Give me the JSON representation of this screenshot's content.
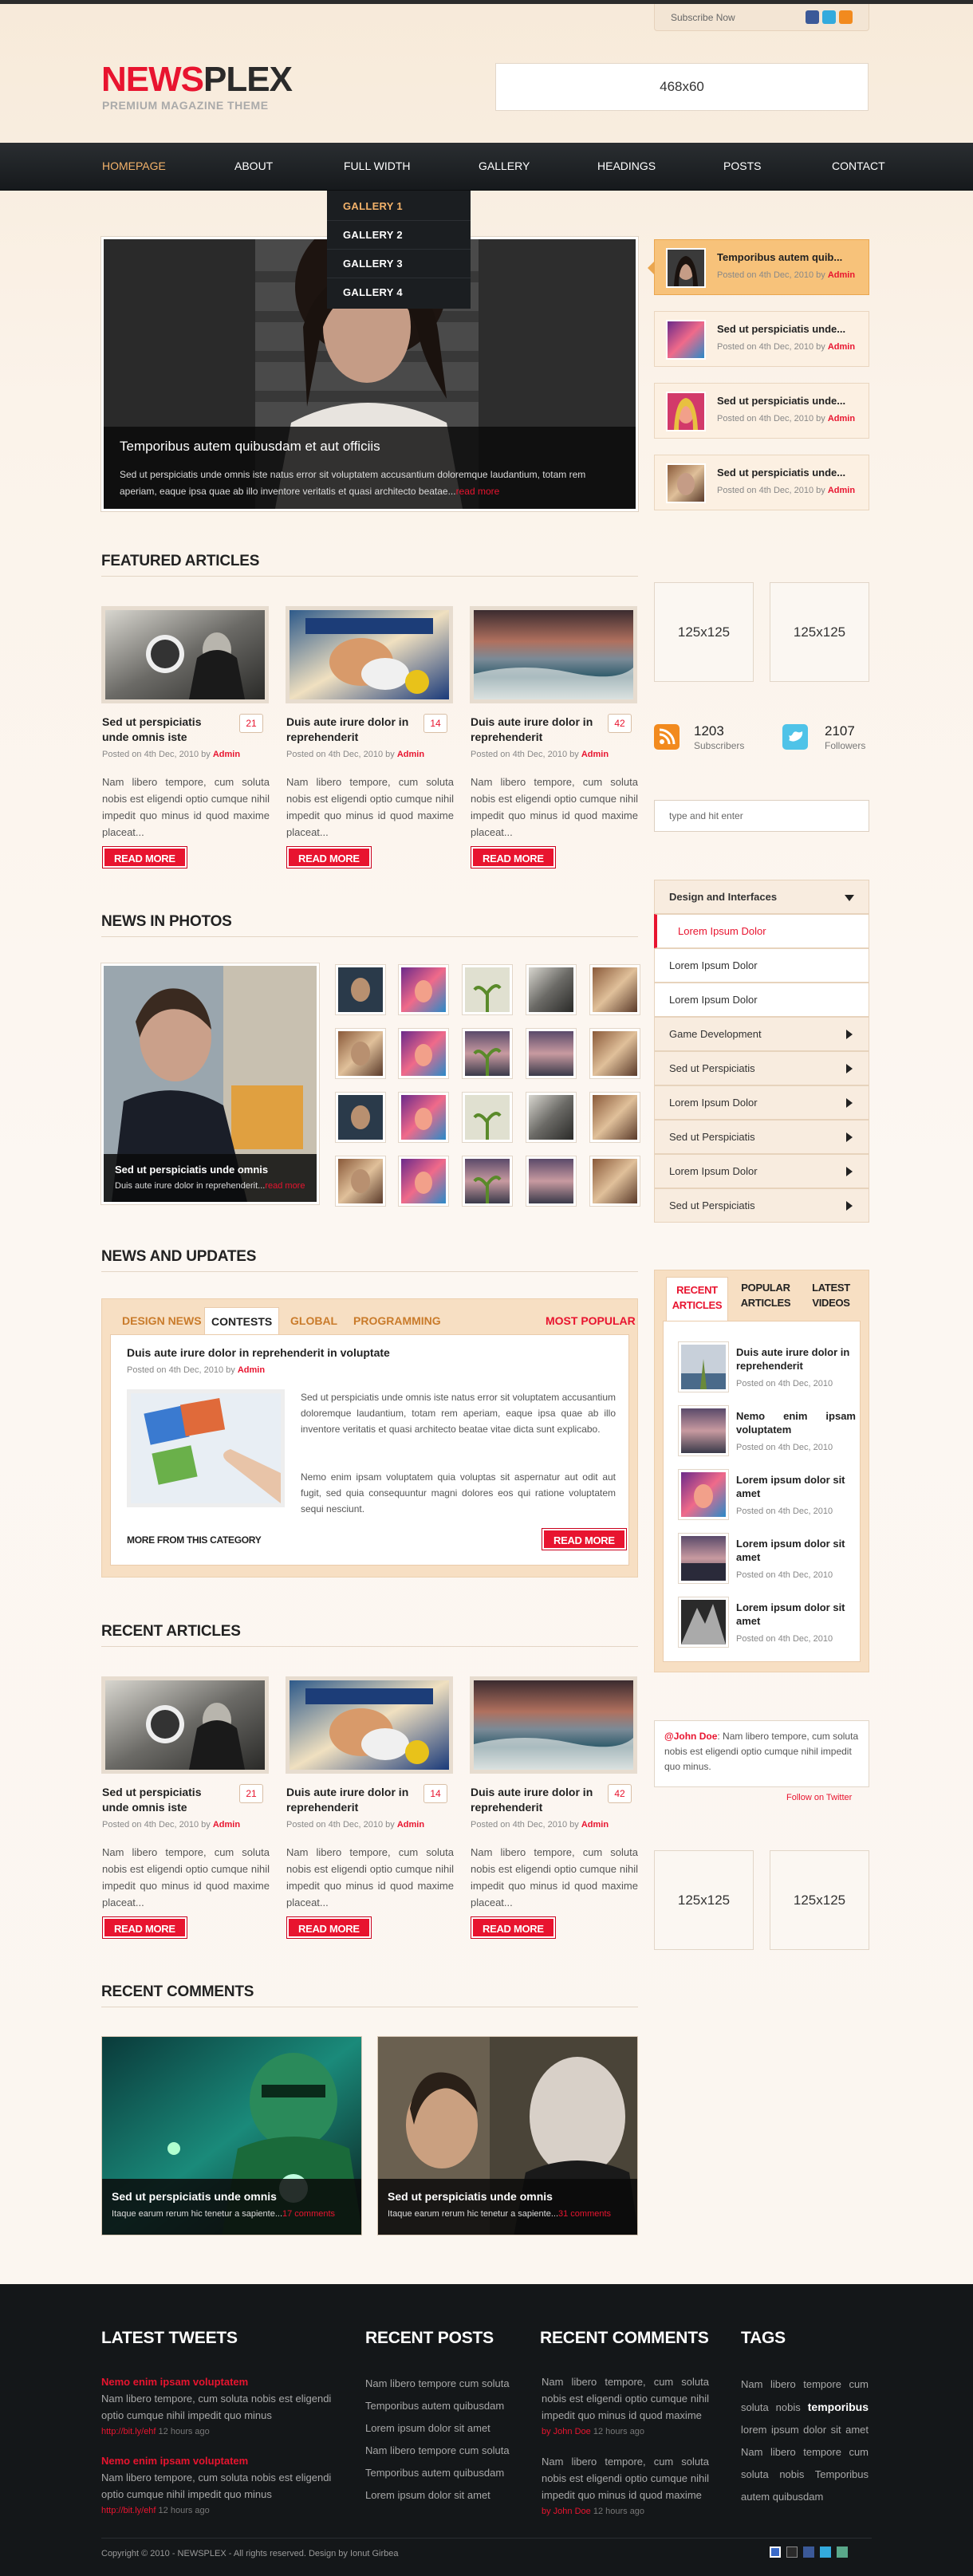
{
  "header": {
    "subscribe": "Subscribe Now",
    "logo_a": "NEWS",
    "logo_b": "PLEX",
    "tagline": "PREMIUM MAGAZINE THEME",
    "ad": "468x60"
  },
  "nav": {
    "items": [
      "HOMEPAGE",
      "ABOUT",
      "FULL WIDTH",
      "GALLERY",
      "HEADINGS",
      "POSTS",
      "CONTACT"
    ],
    "dropdown": [
      "GALLERY 1",
      "GALLERY 2",
      "GALLERY 3",
      "GALLERY 4"
    ]
  },
  "slider": {
    "title": "Temporibus autem quibusdam et aut officiis",
    "text": "Sed ut perspiciatis unde omnis iste natus error sit voluptatem accusantium doloremque laudantium, totam rem aperiam, eaque ipsa quae ab illo inventore veritatis et quasi architecto beatae...",
    "more": "read more",
    "thumbs": [
      {
        "title": "Temporibus autem quib...",
        "date": "Posted on 4th Dec, 2010 by ",
        "author": "Admin"
      },
      {
        "title": "Sed ut perspiciatis unde...",
        "date": "Posted on 4th Dec, 2010 by ",
        "author": "Admin"
      },
      {
        "title": "Sed ut perspiciatis unde...",
        "date": "Posted on 4th Dec, 2010 by ",
        "author": "Admin"
      },
      {
        "title": "Sed ut perspiciatis unde...",
        "date": "Posted on 4th Dec, 2010 by ",
        "author": "Admin"
      }
    ]
  },
  "featured": {
    "title": "FEATURED ARTICLES",
    "cards": [
      {
        "title": "Sed ut perspiciatis unde omnis iste",
        "count": "21",
        "date": "Posted on 4th Dec, 2010 by ",
        "author": "Admin",
        "text": "Nam libero tempore, cum soluta nobis est eligendi optio cumque nihil impedit quo minus id quod maxime placeat...",
        "btn": "READ MORE"
      },
      {
        "title": "Duis aute irure dolor in reprehenderit",
        "count": "14",
        "date": "Posted on 4th Dec, 2010 by ",
        "author": "Admin",
        "text": "Nam libero tempore, cum soluta nobis est eligendi optio cumque nihil impedit quo minus id quod maxime placeat...",
        "btn": "READ MORE"
      },
      {
        "title": "Duis aute irure dolor in reprehenderit",
        "count": "42",
        "date": "Posted on 4th Dec, 2010 by ",
        "author": "Admin",
        "text": "Nam libero tempore, cum soluta nobis est eligendi optio cumque nihil impedit quo minus id quod maxime placeat...",
        "btn": "READ MORE"
      }
    ]
  },
  "sidebar": {
    "ad1": "125x125",
    "ad2": "125x125",
    "subs_count": "1203",
    "subs_label": "Subscribers",
    "foll_count": "2107",
    "foll_label": "Followers",
    "search_placeholder": "type and hit enter",
    "menu": [
      "Design and Interfaces",
      "Lorem Ipsum Dolor",
      "Lorem Ipsum Dolor",
      "Lorem Ipsum Dolor",
      "Game Development",
      "Sed ut Perspiciatis",
      "Lorem Ipsum Dolor",
      "Sed ut Perspiciatis",
      "Lorem Ipsum Dolor",
      "Sed ut Perspiciatis"
    ],
    "rtabs": [
      "RECENT ARTICLES",
      "POPULAR ARTICLES",
      "LATEST VIDEOS"
    ],
    "recent": [
      {
        "title": "Duis aute irure dolor in reprehenderit",
        "date": "Posted on 4th Dec, 2010"
      },
      {
        "title": "Nemo enim ipsam voluptatem",
        "date": "Posted on 4th Dec, 2010"
      },
      {
        "title": "Lorem ipsum dolor sit amet",
        "date": "Posted on 4th Dec, 2010"
      },
      {
        "title": "Lorem ipsum dolor sit amet",
        "date": "Posted on 4th Dec, 2010"
      },
      {
        "title": "Lorem ipsum dolor sit amet",
        "date": "Posted on 4th Dec, 2010"
      }
    ],
    "tweet_user": "@John Doe",
    "tweet_text": ": Nam libero tempore, cum soluta nobis est eligendi optio cumque nihil impedit quo minus.",
    "follow": "Follow on Twitter",
    "ad3": "125x125",
    "ad4": "125x125"
  },
  "photos": {
    "title": "NEWS IN PHOTOS",
    "caption": "Sed ut perspiciatis unde omnis",
    "text": "Duis aute irure dolor in reprehenderit...",
    "more": "read more"
  },
  "news": {
    "title": "NEWS AND UPDATES",
    "tabs": [
      "DESIGN NEWS",
      "CONTESTS",
      "GLOBAL",
      "PROGRAMMING"
    ],
    "popular": "MOST POPULAR",
    "article_title": "Duis aute irure dolor in reprehenderit in voluptate",
    "date": "Posted on 4th Dec, 2010 by ",
    "author": "Admin",
    "p1": "Sed ut perspiciatis unde omnis iste natus error sit voluptatem accusantium doloremque laudantium, totam rem aperiam, eaque ipsa quae ab illo inventore veritatis et quasi architecto beatae vitae dicta sunt explicabo.",
    "p2": "Nemo enim ipsam voluptatem quia voluptas sit aspernatur aut odit aut fugit, sed quia consequuntur magni dolores eos qui ratione voluptatem sequi nesciunt.",
    "more_cat": "MORE FROM THIS CATEGORY",
    "btn": "READ MORE"
  },
  "recent_articles": {
    "title": "RECENT ARTICLES",
    "cards": [
      {
        "title": "Sed ut perspiciatis unde omnis iste",
        "count": "21",
        "date": "Posted on 4th Dec, 2010 by ",
        "author": "Admin",
        "text": "Nam libero tempore, cum soluta nobis est eligendi optio cumque nihil impedit quo minus id quod maxime placeat...",
        "btn": "READ MORE"
      },
      {
        "title": "Duis aute irure dolor in reprehenderit",
        "count": "14",
        "date": "Posted on 4th Dec, 2010 by ",
        "author": "Admin",
        "text": "Nam libero tempore, cum soluta nobis est eligendi optio cumque nihil impedit quo minus id quod maxime placeat...",
        "btn": "READ MORE"
      },
      {
        "title": "Duis aute irure dolor in reprehenderit",
        "count": "42",
        "date": "Posted on 4th Dec, 2010 by ",
        "author": "Admin",
        "text": "Nam libero tempore, cum soluta nobis est eligendi optio cumque nihil impedit quo minus id quod maxime placeat...",
        "btn": "READ MORE"
      }
    ]
  },
  "comments": {
    "title": "RECENT COMMENTS",
    "items": [
      {
        "title": "Sed ut perspiciatis unde omnis",
        "text": "Itaque earum rerum hic tenetur a sapiente...",
        "count": "17 comments"
      },
      {
        "title": "Sed ut perspiciatis unde omnis",
        "text": "Itaque earum rerum hic tenetur a sapiente...",
        "count": "31 comments"
      }
    ]
  },
  "footer": {
    "tweets_title": "LATEST TWEETS",
    "tweets": [
      {
        "title": "Nemo enim ipsam voluptatem",
        "text": "Nam libero tempore, cum soluta nobis est eligendi optio cumque nihil impedit quo minus",
        "link": "http://bit.ly/ehf",
        "time": "12 hours ago"
      },
      {
        "title": "Nemo enim ipsam voluptatem",
        "text": "Nam libero tempore, cum soluta nobis est eligendi optio cumque nihil impedit quo minus",
        "link": "http://bit.ly/ehf",
        "time": "12 hours ago"
      }
    ],
    "posts_title": "RECENT POSTS",
    "posts": [
      "Nam libero tempore cum soluta",
      "Temporibus autem quibusdam",
      "Lorem ipsum dolor sit amet",
      "Nam libero tempore cum soluta",
      "Temporibus autem quibusdam",
      "Lorem ipsum dolor sit amet"
    ],
    "comments_title": "RECENT COMMENTS",
    "comments": [
      {
        "text": "Nam libero tempore, cum soluta nobis est eligendi optio cumque nihil impedit quo minus id quod maxime",
        "by": "by John Doe",
        "time": "12 hours ago"
      },
      {
        "text": "Nam libero tempore, cum soluta nobis est eligendi optio cumque nihil impedit quo minus id quod maxime",
        "by": "by John Doe",
        "time": "12 hours ago"
      }
    ],
    "tags_title": "TAGS",
    "tags_a": "Nam libero tempore cum soluta nobis",
    "tags_bold": "temporibus",
    "tags_b": "lorem ipsum dolor sit amet",
    "tags_c": "Nam libero tempore cum soluta nobis Temporibus autem quibusdam",
    "copyright": "Copyright © 2010 - NEWSPLEX - All rights reserved. Design by Ionut Girbea"
  },
  "colors": {
    "accent": "#e8142f",
    "nav_active": "#f3b26a",
    "dark": "#141719"
  }
}
